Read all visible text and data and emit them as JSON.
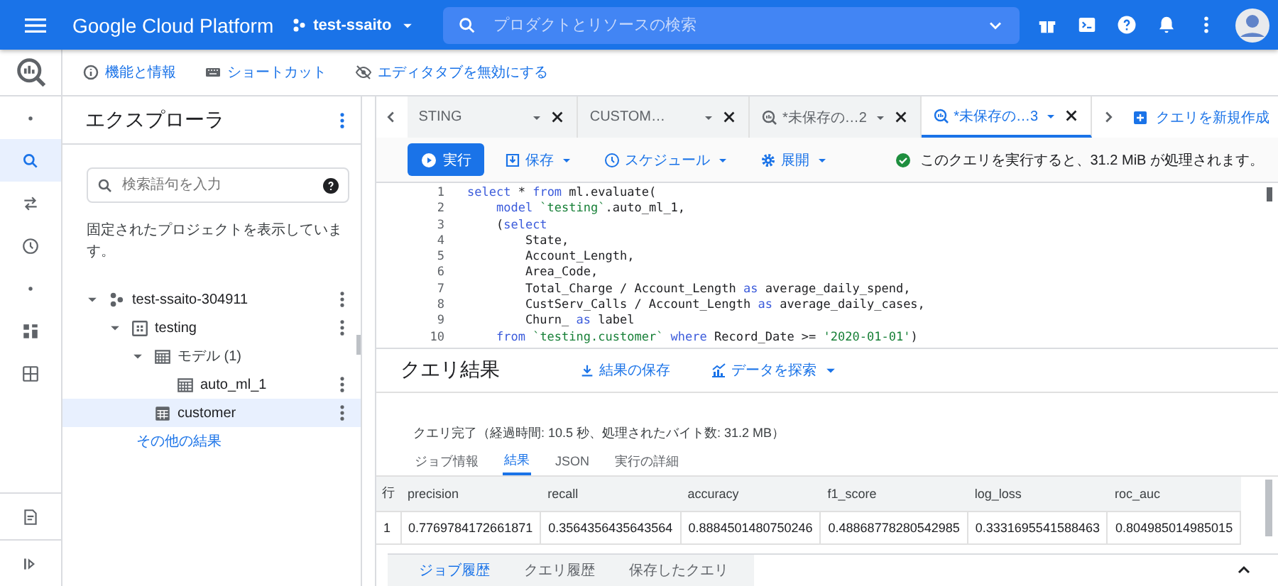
{
  "header": {
    "brand": "Google Cloud Platform",
    "project": "test-ssaito",
    "search_placeholder": "プロダクトとリソースの検索"
  },
  "info_bar": [
    {
      "label": "機能と情報"
    },
    {
      "label": "ショートカット"
    },
    {
      "label": "エディタタブを無効にする"
    }
  ],
  "explorer": {
    "title": "エクスプローラ",
    "search_placeholder": "検索語句を入力",
    "pinned_note": "固定されたプロジェクトを表示しています。",
    "more_link": "その他の結果",
    "tree": [
      {
        "kind": "project",
        "label": "test-ssaito-304911",
        "expanded": true,
        "selected": false,
        "menu": true,
        "children": [
          {
            "kind": "dataset",
            "label": "testing",
            "expanded": true,
            "selected": false,
            "menu": true,
            "children": [
              {
                "kind": "folder",
                "label": "モデル (1)",
                "expanded": true,
                "selected": false,
                "menu": false,
                "children": [
                  {
                    "kind": "model",
                    "label": "auto_ml_1",
                    "selected": false,
                    "menu": true
                  }
                ]
              },
              {
                "kind": "table",
                "label": "customer",
                "selected": true,
                "menu": true
              }
            ]
          }
        ]
      }
    ]
  },
  "rail": [
    {
      "kind": "dot",
      "selected": false
    },
    {
      "kind": "search",
      "selected": true
    },
    {
      "kind": "transfer",
      "selected": false
    },
    {
      "kind": "clock",
      "selected": false
    },
    {
      "kind": "dot",
      "selected": false
    },
    {
      "kind": "grid",
      "selected": false
    },
    {
      "kind": "table",
      "selected": false
    }
  ],
  "editor_tabs": [
    {
      "label": "STING",
      "icon": false,
      "selected": false
    },
    {
      "label": "CUSTOM…",
      "icon": false,
      "selected": false
    },
    {
      "label": "*未保存の…2",
      "icon": true,
      "selected": false
    },
    {
      "label": "*未保存の…3",
      "icon": true,
      "selected": true
    }
  ],
  "new_query": "クエリを新規作成",
  "actions": {
    "run": "実行",
    "save": "保存",
    "schedule": "スケジュール",
    "deploy": "展開",
    "validation": "このクエリを実行すると、31.2 MiB が処理されます。"
  },
  "code": [
    {
      "number": "1",
      "tokens": [
        {
          "kind": "keyword",
          "text": "select"
        },
        {
          "kind": "plain",
          "text": " * "
        },
        {
          "kind": "keyword",
          "text": "from"
        },
        {
          "kind": "plain",
          "text": " ml.evaluate("
        }
      ]
    },
    {
      "number": "2",
      "tokens": [
        {
          "kind": "keyword",
          "text": "    model"
        },
        {
          "kind": "string",
          "text": " `testing`"
        },
        {
          "kind": "plain",
          "text": ".auto_ml_1,"
        }
      ]
    },
    {
      "number": "3",
      "tokens": [
        {
          "kind": "plain",
          "text": "    ("
        },
        {
          "kind": "keyword",
          "text": "select"
        }
      ]
    },
    {
      "number": "4",
      "tokens": [
        {
          "kind": "plain",
          "text": "        State,"
        }
      ]
    },
    {
      "number": "5",
      "tokens": [
        {
          "kind": "plain",
          "text": "        Account_Length,"
        }
      ]
    },
    {
      "number": "6",
      "tokens": [
        {
          "kind": "plain",
          "text": "        Area_Code,"
        }
      ]
    },
    {
      "number": "7",
      "tokens": [
        {
          "kind": "plain",
          "text": "        Total_Charge / Account_Length "
        },
        {
          "kind": "keyword",
          "text": "as"
        },
        {
          "kind": "plain",
          "text": " average_daily_spend,"
        }
      ]
    },
    {
      "number": "8",
      "tokens": [
        {
          "kind": "plain",
          "text": "        CustServ_Calls / Account_Length "
        },
        {
          "kind": "keyword",
          "text": "as"
        },
        {
          "kind": "plain",
          "text": " average_daily_cases,"
        }
      ]
    },
    {
      "number": "9",
      "tokens": [
        {
          "kind": "plain",
          "text": "        Churn_ "
        },
        {
          "kind": "keyword",
          "text": "as"
        },
        {
          "kind": "plain",
          "text": " label"
        }
      ]
    },
    {
      "number": "10",
      "tokens": [
        {
          "kind": "keyword",
          "text": "    from"
        },
        {
          "kind": "string",
          "text": " `testing.customer`"
        },
        {
          "kind": "keyword",
          "text": " where"
        },
        {
          "kind": "plain",
          "text": " Record_Date >= "
        },
        {
          "kind": "string",
          "text": "'2020-01-01'"
        },
        {
          "kind": "plain",
          "text": ")"
        }
      ]
    }
  ],
  "results": {
    "title": "クエリ結果",
    "save": "結果の保存",
    "explore": "データを探索",
    "status": "クエリ完了（経過時間: 10.5 秒、処理されたバイト数: 31.2 MB）",
    "tabs": [
      {
        "label": "ジョブ情報",
        "selected": false
      },
      {
        "label": "結果",
        "selected": true
      },
      {
        "label": "JSON",
        "selected": false
      },
      {
        "label": "実行の詳細",
        "selected": false
      }
    ],
    "table": {
      "columns": [
        "行",
        "precision",
        "recall",
        "accuracy",
        "f1_score",
        "log_loss",
        "roc_auc"
      ],
      "rows": [
        [
          "1",
          "0.7769784172661871",
          "0.3564356435643564",
          "0.8884501480750246",
          "0.48868778280542985",
          "0.3331695541588463",
          "0.804985014985015"
        ]
      ]
    }
  },
  "bottom_tabs": [
    {
      "label": "ジョブ履歴",
      "selected": true
    },
    {
      "label": "クエリ履歴",
      "selected": false
    },
    {
      "label": "保存したクエリ",
      "selected": false
    }
  ]
}
